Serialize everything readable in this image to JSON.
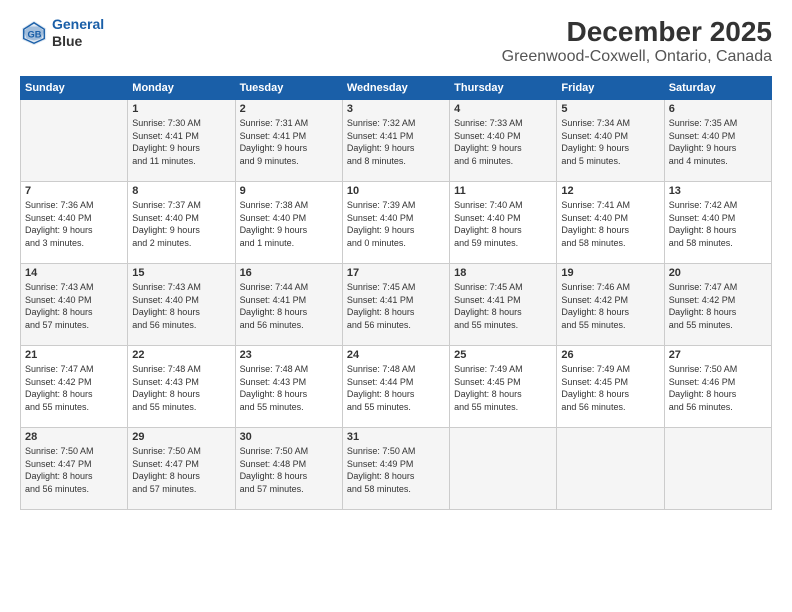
{
  "header": {
    "logo_line1": "General",
    "logo_line2": "Blue",
    "title": "December 2025",
    "subtitle": "Greenwood-Coxwell, Ontario, Canada"
  },
  "columns": [
    "Sunday",
    "Monday",
    "Tuesday",
    "Wednesday",
    "Thursday",
    "Friday",
    "Saturday"
  ],
  "rows": [
    [
      {
        "day": "",
        "info": ""
      },
      {
        "day": "1",
        "info": "Sunrise: 7:30 AM\nSunset: 4:41 PM\nDaylight: 9 hours\nand 11 minutes."
      },
      {
        "day": "2",
        "info": "Sunrise: 7:31 AM\nSunset: 4:41 PM\nDaylight: 9 hours\nand 9 minutes."
      },
      {
        "day": "3",
        "info": "Sunrise: 7:32 AM\nSunset: 4:41 PM\nDaylight: 9 hours\nand 8 minutes."
      },
      {
        "day": "4",
        "info": "Sunrise: 7:33 AM\nSunset: 4:40 PM\nDaylight: 9 hours\nand 6 minutes."
      },
      {
        "day": "5",
        "info": "Sunrise: 7:34 AM\nSunset: 4:40 PM\nDaylight: 9 hours\nand 5 minutes."
      },
      {
        "day": "6",
        "info": "Sunrise: 7:35 AM\nSunset: 4:40 PM\nDaylight: 9 hours\nand 4 minutes."
      }
    ],
    [
      {
        "day": "7",
        "info": "Sunrise: 7:36 AM\nSunset: 4:40 PM\nDaylight: 9 hours\nand 3 minutes."
      },
      {
        "day": "8",
        "info": "Sunrise: 7:37 AM\nSunset: 4:40 PM\nDaylight: 9 hours\nand 2 minutes."
      },
      {
        "day": "9",
        "info": "Sunrise: 7:38 AM\nSunset: 4:40 PM\nDaylight: 9 hours\nand 1 minute."
      },
      {
        "day": "10",
        "info": "Sunrise: 7:39 AM\nSunset: 4:40 PM\nDaylight: 9 hours\nand 0 minutes."
      },
      {
        "day": "11",
        "info": "Sunrise: 7:40 AM\nSunset: 4:40 PM\nDaylight: 8 hours\nand 59 minutes."
      },
      {
        "day": "12",
        "info": "Sunrise: 7:41 AM\nSunset: 4:40 PM\nDaylight: 8 hours\nand 58 minutes."
      },
      {
        "day": "13",
        "info": "Sunrise: 7:42 AM\nSunset: 4:40 PM\nDaylight: 8 hours\nand 58 minutes."
      }
    ],
    [
      {
        "day": "14",
        "info": "Sunrise: 7:43 AM\nSunset: 4:40 PM\nDaylight: 8 hours\nand 57 minutes."
      },
      {
        "day": "15",
        "info": "Sunrise: 7:43 AM\nSunset: 4:40 PM\nDaylight: 8 hours\nand 56 minutes."
      },
      {
        "day": "16",
        "info": "Sunrise: 7:44 AM\nSunset: 4:41 PM\nDaylight: 8 hours\nand 56 minutes."
      },
      {
        "day": "17",
        "info": "Sunrise: 7:45 AM\nSunset: 4:41 PM\nDaylight: 8 hours\nand 56 minutes."
      },
      {
        "day": "18",
        "info": "Sunrise: 7:45 AM\nSunset: 4:41 PM\nDaylight: 8 hours\nand 55 minutes."
      },
      {
        "day": "19",
        "info": "Sunrise: 7:46 AM\nSunset: 4:42 PM\nDaylight: 8 hours\nand 55 minutes."
      },
      {
        "day": "20",
        "info": "Sunrise: 7:47 AM\nSunset: 4:42 PM\nDaylight: 8 hours\nand 55 minutes."
      }
    ],
    [
      {
        "day": "21",
        "info": "Sunrise: 7:47 AM\nSunset: 4:42 PM\nDaylight: 8 hours\nand 55 minutes."
      },
      {
        "day": "22",
        "info": "Sunrise: 7:48 AM\nSunset: 4:43 PM\nDaylight: 8 hours\nand 55 minutes."
      },
      {
        "day": "23",
        "info": "Sunrise: 7:48 AM\nSunset: 4:43 PM\nDaylight: 8 hours\nand 55 minutes."
      },
      {
        "day": "24",
        "info": "Sunrise: 7:48 AM\nSunset: 4:44 PM\nDaylight: 8 hours\nand 55 minutes."
      },
      {
        "day": "25",
        "info": "Sunrise: 7:49 AM\nSunset: 4:45 PM\nDaylight: 8 hours\nand 55 minutes."
      },
      {
        "day": "26",
        "info": "Sunrise: 7:49 AM\nSunset: 4:45 PM\nDaylight: 8 hours\nand 56 minutes."
      },
      {
        "day": "27",
        "info": "Sunrise: 7:50 AM\nSunset: 4:46 PM\nDaylight: 8 hours\nand 56 minutes."
      }
    ],
    [
      {
        "day": "28",
        "info": "Sunrise: 7:50 AM\nSunset: 4:47 PM\nDaylight: 8 hours\nand 56 minutes."
      },
      {
        "day": "29",
        "info": "Sunrise: 7:50 AM\nSunset: 4:47 PM\nDaylight: 8 hours\nand 57 minutes."
      },
      {
        "day": "30",
        "info": "Sunrise: 7:50 AM\nSunset: 4:48 PM\nDaylight: 8 hours\nand 57 minutes."
      },
      {
        "day": "31",
        "info": "Sunrise: 7:50 AM\nSunset: 4:49 PM\nDaylight: 8 hours\nand 58 minutes."
      },
      {
        "day": "",
        "info": ""
      },
      {
        "day": "",
        "info": ""
      },
      {
        "day": "",
        "info": ""
      }
    ]
  ]
}
